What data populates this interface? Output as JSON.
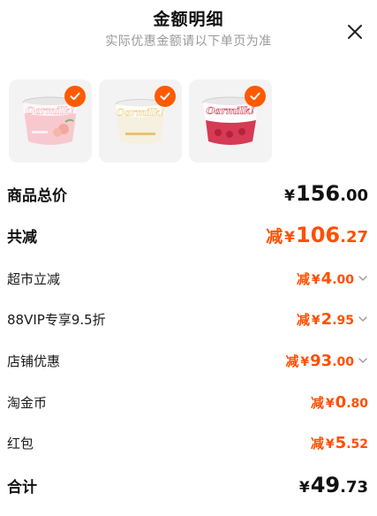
{
  "header": {
    "title": "金额明细",
    "subtitle": "实际优惠金额请以下单页为准"
  },
  "products": [
    {
      "brand": "Oarmilk!",
      "flavor": "peach",
      "cup_color": "#f7c9cf",
      "checked": true
    },
    {
      "brand": "Oarmilk!",
      "flavor": "original",
      "cup_color": "#f5f0df",
      "checked": true
    },
    {
      "brand": "Oarmilk!",
      "flavor": "raspberry",
      "cup_color": "#d63a54",
      "checked": true
    }
  ],
  "summary": {
    "goods_total": {
      "label": "商品总价",
      "currency": "¥",
      "int": "156",
      "dec": ".00"
    },
    "total_discount": {
      "label": "共减",
      "prefix": "减",
      "currency": "¥",
      "int": "106",
      "dec": ".27"
    },
    "discounts": [
      {
        "label": "超市立减",
        "prefix": "减",
        "currency": "¥",
        "int": "4",
        "dec": ".00",
        "expandable": true
      },
      {
        "label": "88VIP专享9.5折",
        "prefix": "减",
        "currency": "¥",
        "int": "2",
        "dec": ".95",
        "expandable": true
      },
      {
        "label": "店铺优惠",
        "prefix": "减",
        "currency": "¥",
        "int": "93",
        "dec": ".00",
        "expandable": true
      },
      {
        "label": "淘金币",
        "prefix": "减",
        "currency": "¥",
        "int": "0",
        "dec": ".80",
        "expandable": false
      },
      {
        "label": "红包",
        "prefix": "减",
        "currency": "¥",
        "int": "5",
        "dec": ".52",
        "expandable": false
      }
    ],
    "final_total": {
      "label": "合计",
      "currency": "¥",
      "int": "49",
      "dec": ".73"
    }
  },
  "colors": {
    "accent": "#ff4f00",
    "check": "#ff5a00",
    "thumb_bg": "#f3f3f3"
  }
}
